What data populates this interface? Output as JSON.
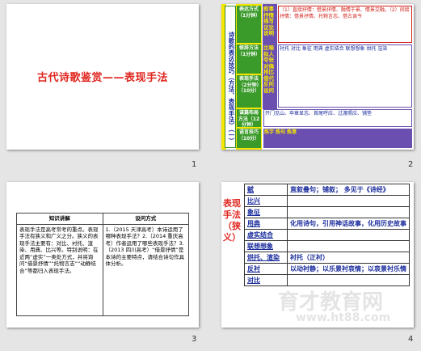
{
  "slide1": {
    "title": "古代诗歌鉴赏——表现手法",
    "number": "1"
  },
  "slide2": {
    "number": "2",
    "vertical_main": "诗歌的表达技巧（方法、表现手法）（一）",
    "label_express": "表达方式（1分钟）",
    "label_rhetoric": "修辞方法（1分钟）",
    "label_technique": "表现手法（2分钟）（10分）",
    "label_structure": "谋篇布局方法（12分钟）",
    "label_language": "语言技巧（10分）",
    "box_a": "叙事 抒情 描写 议论 说明",
    "box_b": "比喻 拟人 夸张 对偶 排比 借代 反问 设问",
    "box_c": "（1）直接抒情：借景抒情、融情于景、情景交融。（2）间接抒情：借景抒情、托物言志、借古讽今",
    "box_d": "衬托 对比 象征 用典 虚实结合 联想想象 烘托 渲染",
    "box_e": "开门见山、卒章显志、首尾呼应、过渡照应、铺垫",
    "box_f": "炼字 炼句 炼意"
  },
  "slide3": {
    "number": "3",
    "col1_header": "知识讲解",
    "col2_header": "设问方式",
    "col1_body": "表现手法是高考常考的重点。表现手法有狭义和广义之分。狭义的表现手法主要有：对比、衬托、渲染、用典、比兴等。特别说明：在近两“虚实”一类处方式，并将询问“借景抒情”“托物言志”“动静结合”等都归入表现手法。",
    "col2_body": "1.（2015 天津高考）本诗运用了哪种表现手法？2.（2014 重庆高考）作者运用了哪些表现手法？3.（2013 四川高考）“借景抒情”是本诗的主要特点，请结合诗句作具体分析。"
  },
  "slide4": {
    "number": "4",
    "side_label": "表现手法（狭义）",
    "rows": [
      {
        "term": "赋",
        "desc": "直叙叠句；铺叙； 多见于《诗经》"
      },
      {
        "term": "比兴",
        "desc": ""
      },
      {
        "term": "象征",
        "desc": ""
      },
      {
        "term": "用典",
        "desc": "化用诗句，引用神话故事，化用历史故事"
      },
      {
        "term": "虚实结合",
        "desc": ""
      },
      {
        "term": "联想想象",
        "desc": ""
      },
      {
        "term": "烘托、渲染",
        "desc": "衬托（正衬）"
      },
      {
        "term": "反衬",
        "desc": "以动衬静；以乐景衬哀情；以哀景衬乐情"
      },
      {
        "term": "对比",
        "desc": ""
      }
    ]
  },
  "watermark": {
    "cn": "育才教育网",
    "url": "www.ht88.com"
  }
}
